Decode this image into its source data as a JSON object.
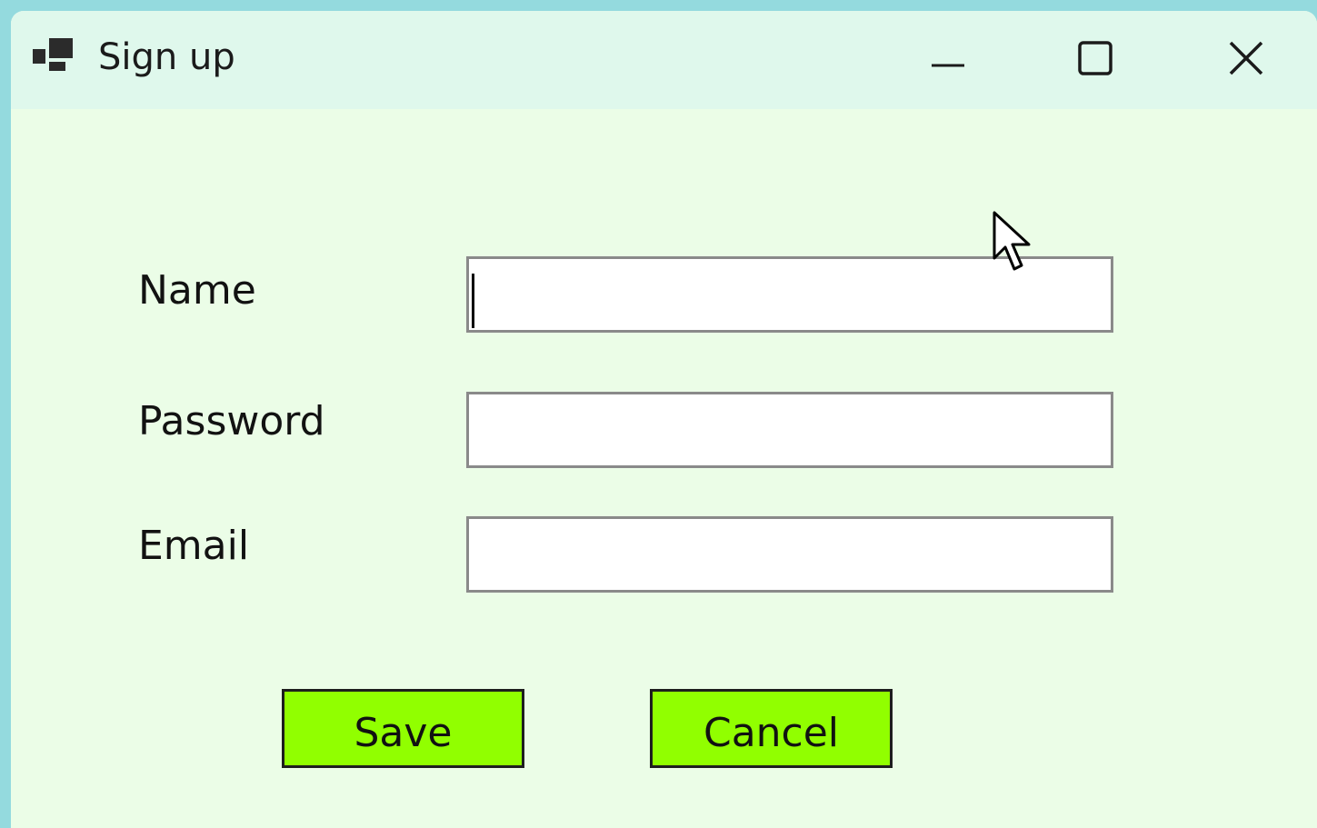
{
  "window": {
    "title": "Sign up",
    "controls": {
      "minimize_icon": "minimize-icon",
      "maximize_icon": "maximize-icon",
      "close_icon": "close-icon"
    }
  },
  "form": {
    "fields": [
      {
        "label": "Name",
        "value": "",
        "placeholder": ""
      },
      {
        "label": "Password",
        "value": "",
        "placeholder": ""
      },
      {
        "label": "Email",
        "value": "",
        "placeholder": ""
      }
    ]
  },
  "buttons": {
    "save_label": "Save",
    "cancel_label": "Cancel"
  },
  "colors": {
    "desktop_background": "#94dade",
    "window_background": "#ebfde7",
    "titlebar_background": "#dff8ec",
    "button_background": "#91ff00",
    "field_border": "#8a8a8a"
  }
}
